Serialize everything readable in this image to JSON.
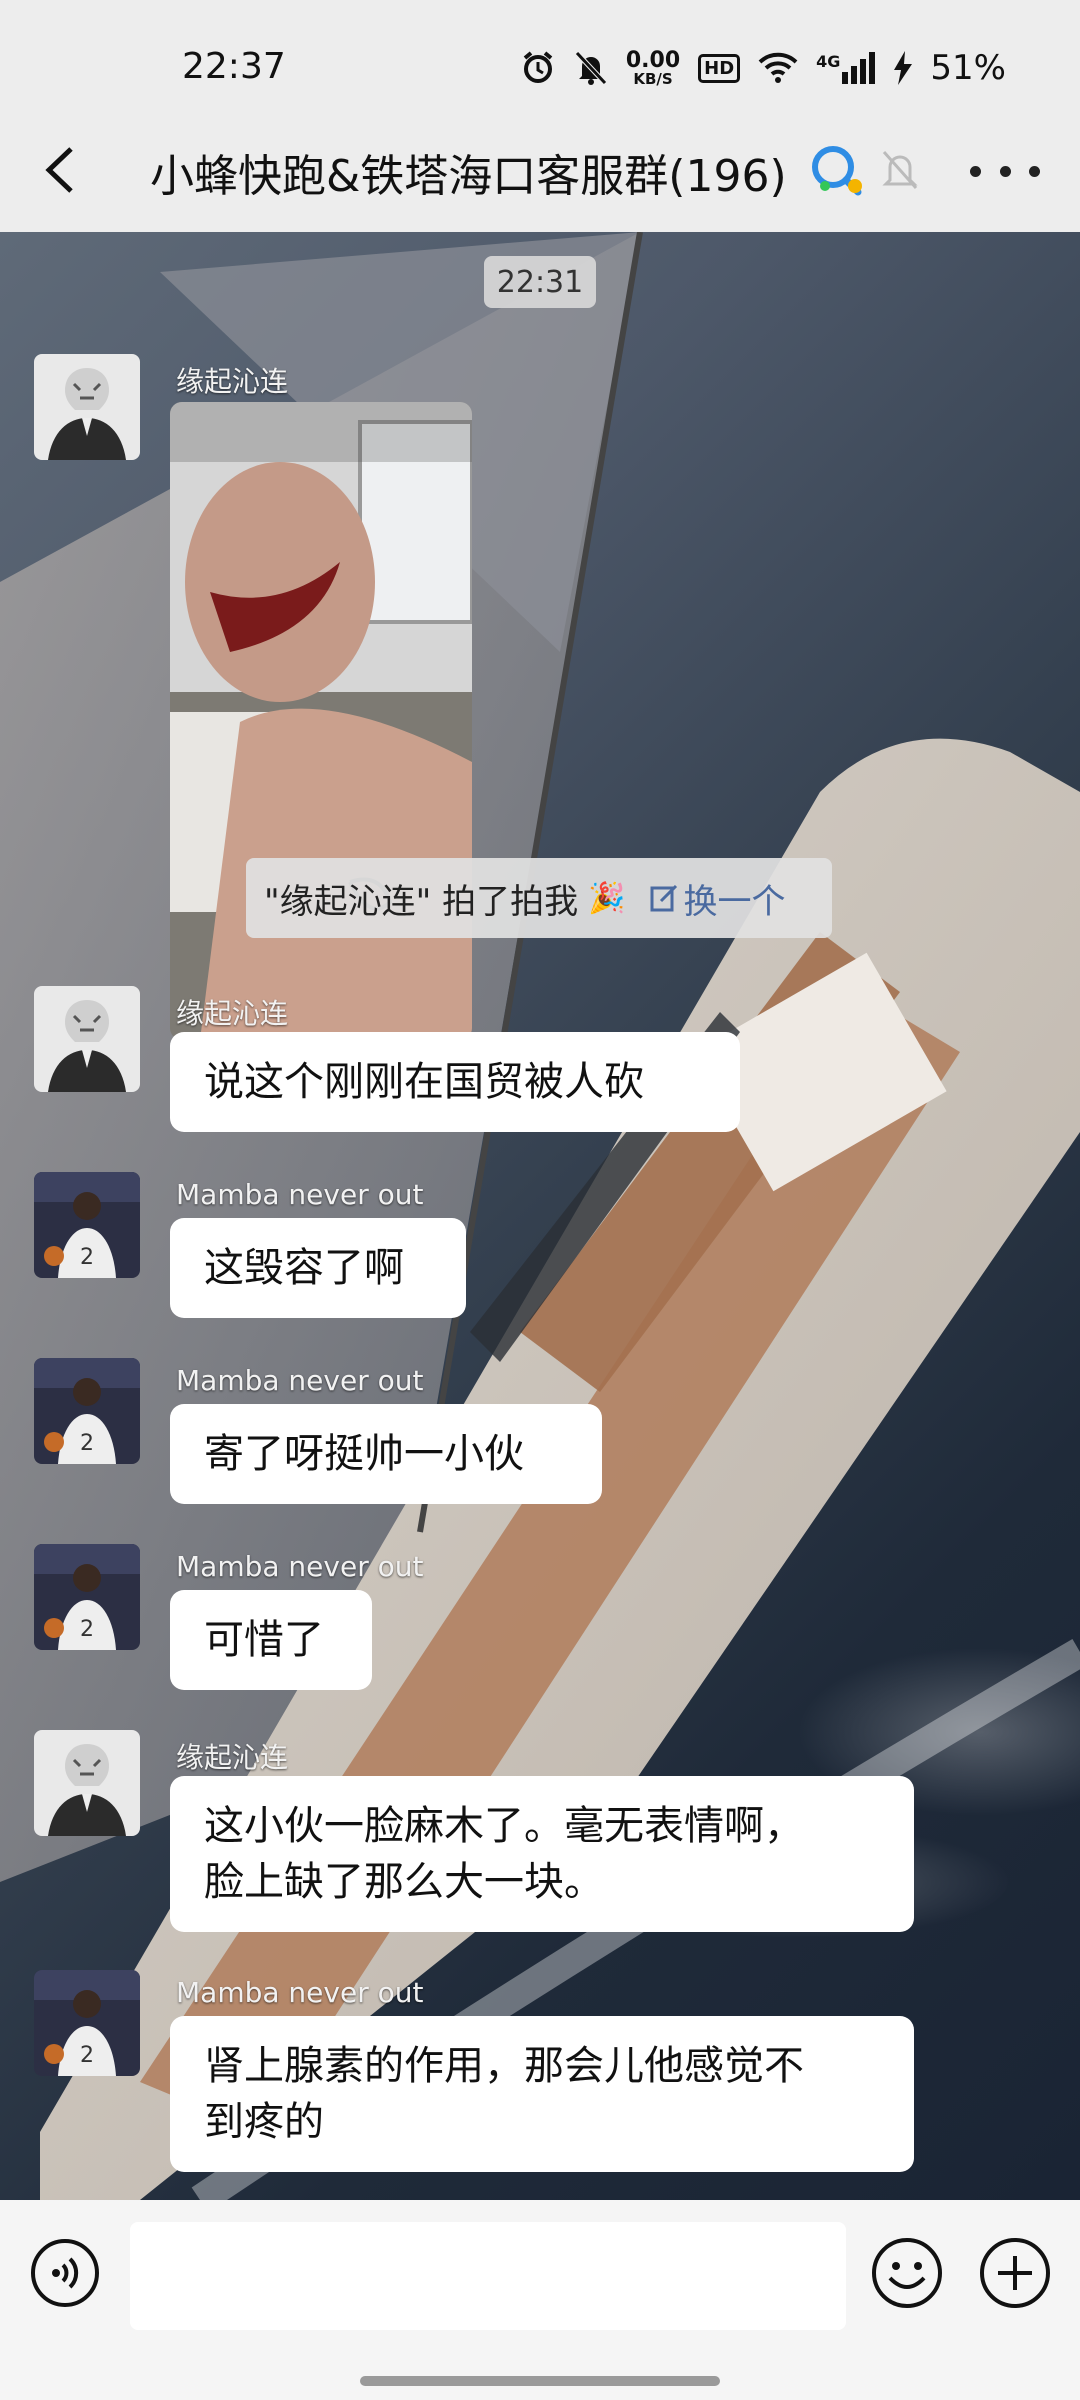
{
  "status_bar": {
    "time": "22:37",
    "net_speed_value": "0.00",
    "net_speed_unit": "KB/S",
    "hd": "HD",
    "network": "4G",
    "battery": "51%"
  },
  "header": {
    "title": "小蜂快跑&铁塔海口客服群(196)"
  },
  "chat": {
    "timestamp": "22:31",
    "system_notice": {
      "text": "\"缘起沁连\" 拍了拍我",
      "action": "换一个"
    },
    "messages": [
      {
        "sender": "缘起沁连",
        "type": "image"
      },
      {
        "sender": "缘起沁连",
        "text": "说这个刚刚在国贸被人砍"
      },
      {
        "sender": "Mamba never out",
        "text": "这毁容了啊"
      },
      {
        "sender": "Mamba never out",
        "text": "寄了呀挺帅一小伙"
      },
      {
        "sender": "Mamba never out",
        "text": "可惜了"
      },
      {
        "sender": "缘起沁连",
        "line1": "这小伙一脸麻木了。毫无表情啊，",
        "line2": "脸上缺了那么大一块。"
      },
      {
        "sender": "Mamba never out",
        "line1": "肾上腺素的作用，那会儿他感觉不",
        "line2": "到疼的"
      }
    ]
  },
  "icons": {
    "back": "chevron-left-icon",
    "group_search": "search-people-icon",
    "mute": "bell-muted-icon",
    "more": "more-dots-icon",
    "voice": "voice-icon",
    "emoji": "emoji-icon",
    "plus": "plus-icon"
  }
}
